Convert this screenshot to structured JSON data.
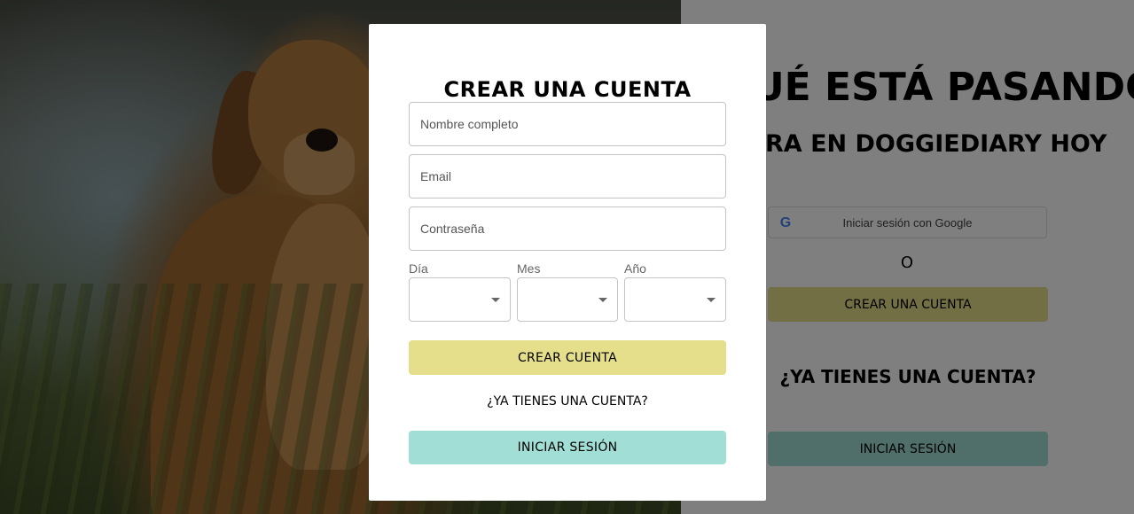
{
  "background": {
    "headline": "¿QUÉ ESTÁ PASANDO?",
    "subheadline": "ENTRA EN DOGGIEDIARY HOY",
    "google_button_label": "Iniciar sesión con Google",
    "google_icon": "google-g-icon",
    "or_text": "O",
    "create_account_label": "CREAR UNA CUENTA",
    "have_account_text": "¿YA TIENES UNA CUENTA?",
    "login_label": "INICIAR SESIÓN",
    "hero_image": "golden-retriever-photo"
  },
  "modal": {
    "title": "CREAR UNA CUENTA",
    "fields": {
      "full_name": {
        "placeholder": "Nombre completo",
        "value": ""
      },
      "email": {
        "placeholder": "Email",
        "value": ""
      },
      "password": {
        "placeholder": "Contraseña",
        "value": ""
      }
    },
    "birthdate": {
      "day_label": "Día",
      "month_label": "Mes",
      "year_label": "Año",
      "day_value": "",
      "month_value": "",
      "year_value": ""
    },
    "create_button_label": "CREAR CUENTA",
    "have_account_text": "¿YA TIENES UNA CUENTA?",
    "login_button_label": "INICIAR SESIÓN"
  },
  "colors": {
    "create_button": "#e5df8b",
    "login_button": "#a1ded5",
    "overlay": "rgba(0,0,0,0.5)"
  }
}
